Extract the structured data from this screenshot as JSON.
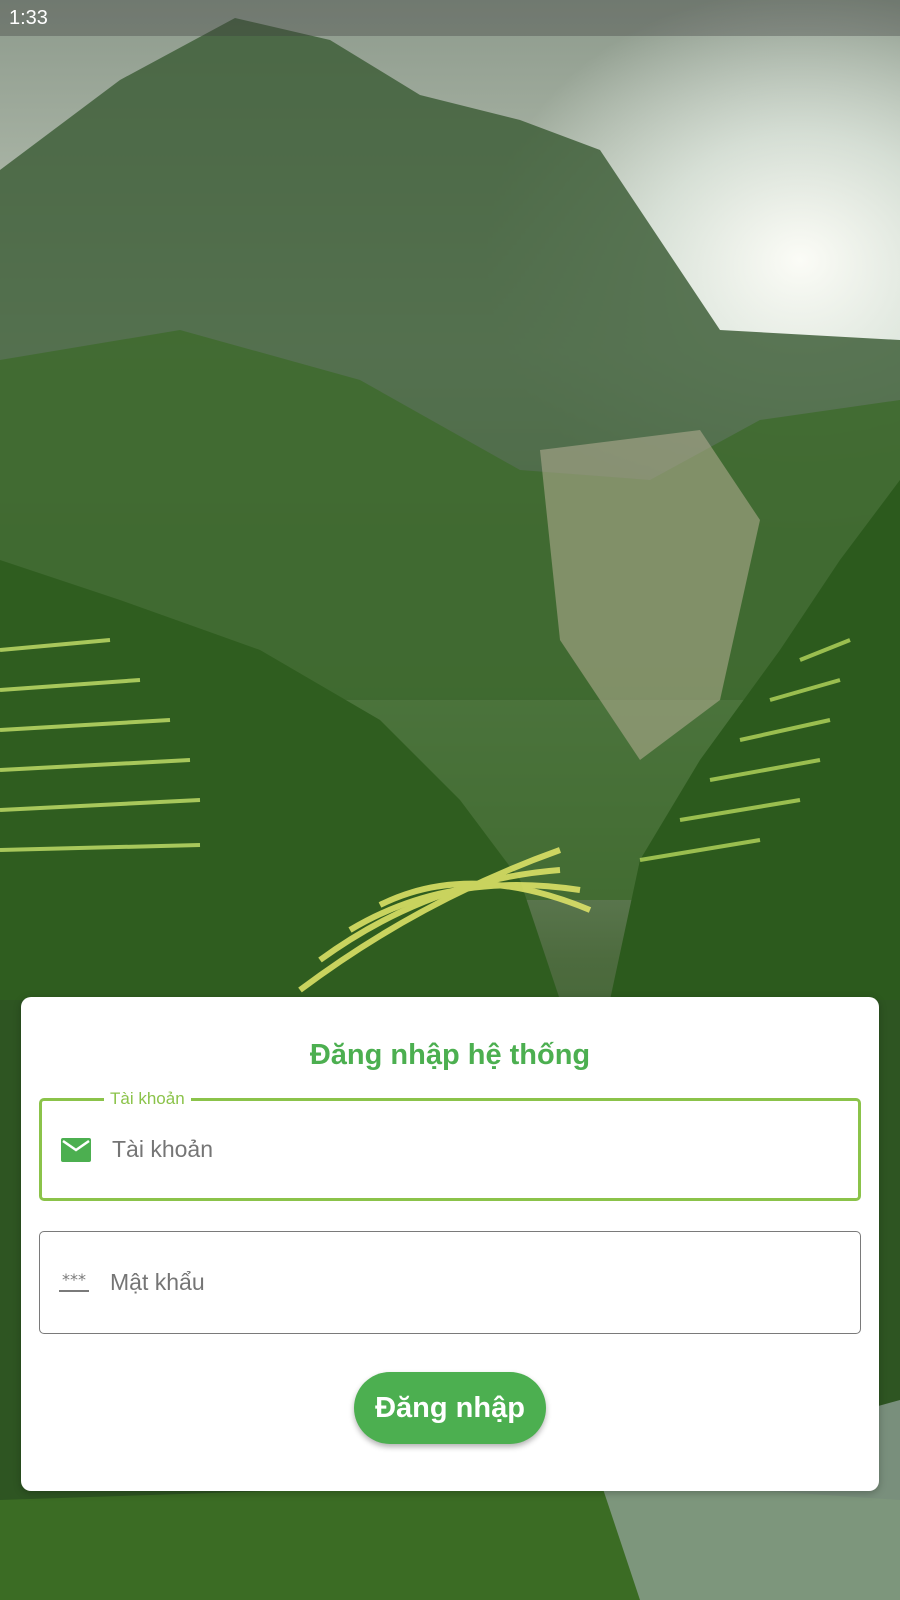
{
  "status_bar": {
    "time": "1:33"
  },
  "background": {
    "image": "terraced-rice-fields-mountain-landscape"
  },
  "login": {
    "title": "Đăng nhập hệ thống",
    "username": {
      "label": "Tài khoản",
      "placeholder": "Tài khoản",
      "value": "",
      "icon": "mail-icon"
    },
    "password": {
      "placeholder": "Mật khẩu",
      "value": "",
      "icon": "password-icon"
    },
    "submit_label": "Đăng nhập"
  },
  "colors": {
    "primary": "#4caf50",
    "focus_border": "#8bc34a",
    "idle_border": "#7a7a7a",
    "card_background": "#ffffff"
  }
}
